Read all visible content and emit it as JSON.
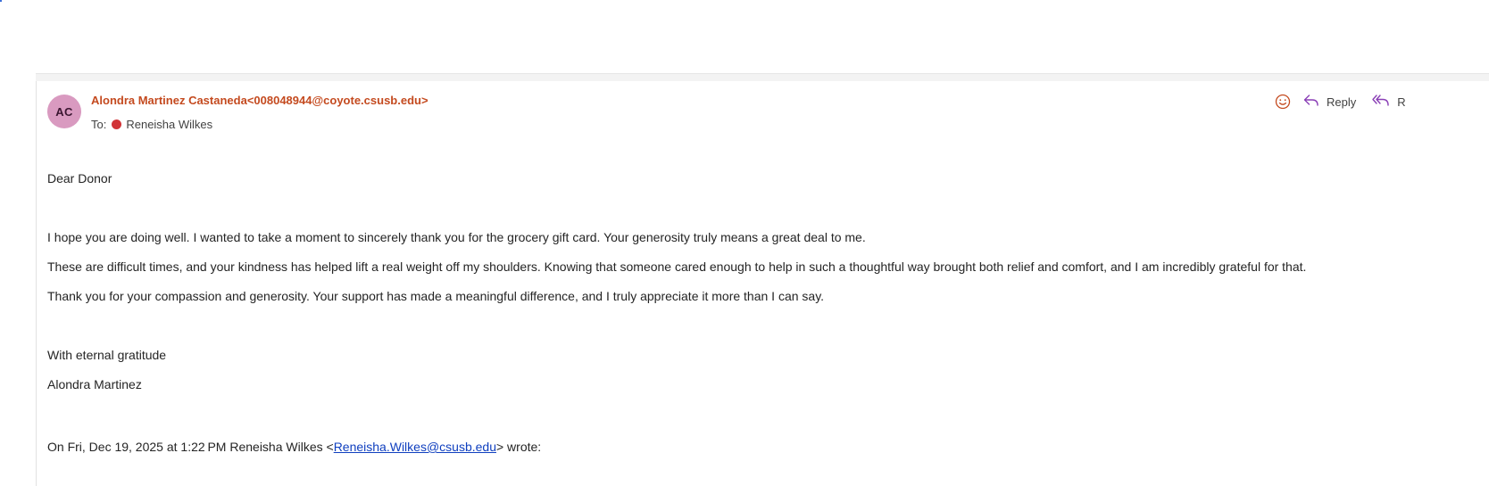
{
  "message": {
    "sender_initials": "AC",
    "sender_display": "Alondra Martinez Castaneda<008048944@coyote.csusb.edu>",
    "to_label": "To:",
    "recipient_name": "Reneisha Wilkes",
    "actions": {
      "reply_label": "Reply",
      "reply_all_label": "R"
    },
    "body": {
      "greeting": "Dear Donor",
      "paragraph_1": "I hope you are doing well. I wanted to take a moment to sincerely thank you for the grocery gift card. Your generosity truly means a great deal to me.",
      "paragraph_2": "These are difficult times, and your kindness has helped lift a real weight off my shoulders. Knowing that someone cared enough to help in such a thoughtful way brought both relief and comfort, and I am incredibly grateful for that.",
      "paragraph_3": "Thank you for your compassion and generosity. Your support has made a meaningful difference, and I truly appreciate it more than I can say.",
      "closing": "With eternal gratitude",
      "signature": "Alondra Martinez"
    },
    "quote": {
      "prefix": "On Fri, Dec 19, 2025 at 1:22 PM Reneisha Wilkes <",
      "email": "Reneisha.Wilkes@csusb.edu",
      "suffix": "> wrote:"
    }
  },
  "colors": {
    "sender": "#c44a1f",
    "avatar_bg": "#d99ac0",
    "presence": "#d13438",
    "accent_purple": "#8a3fb6",
    "link": "#0f3fbf"
  },
  "icons": {
    "emoji": "smiley-icon",
    "reply": "reply-arrow-icon",
    "reply_all": "reply-all-arrow-icon"
  }
}
